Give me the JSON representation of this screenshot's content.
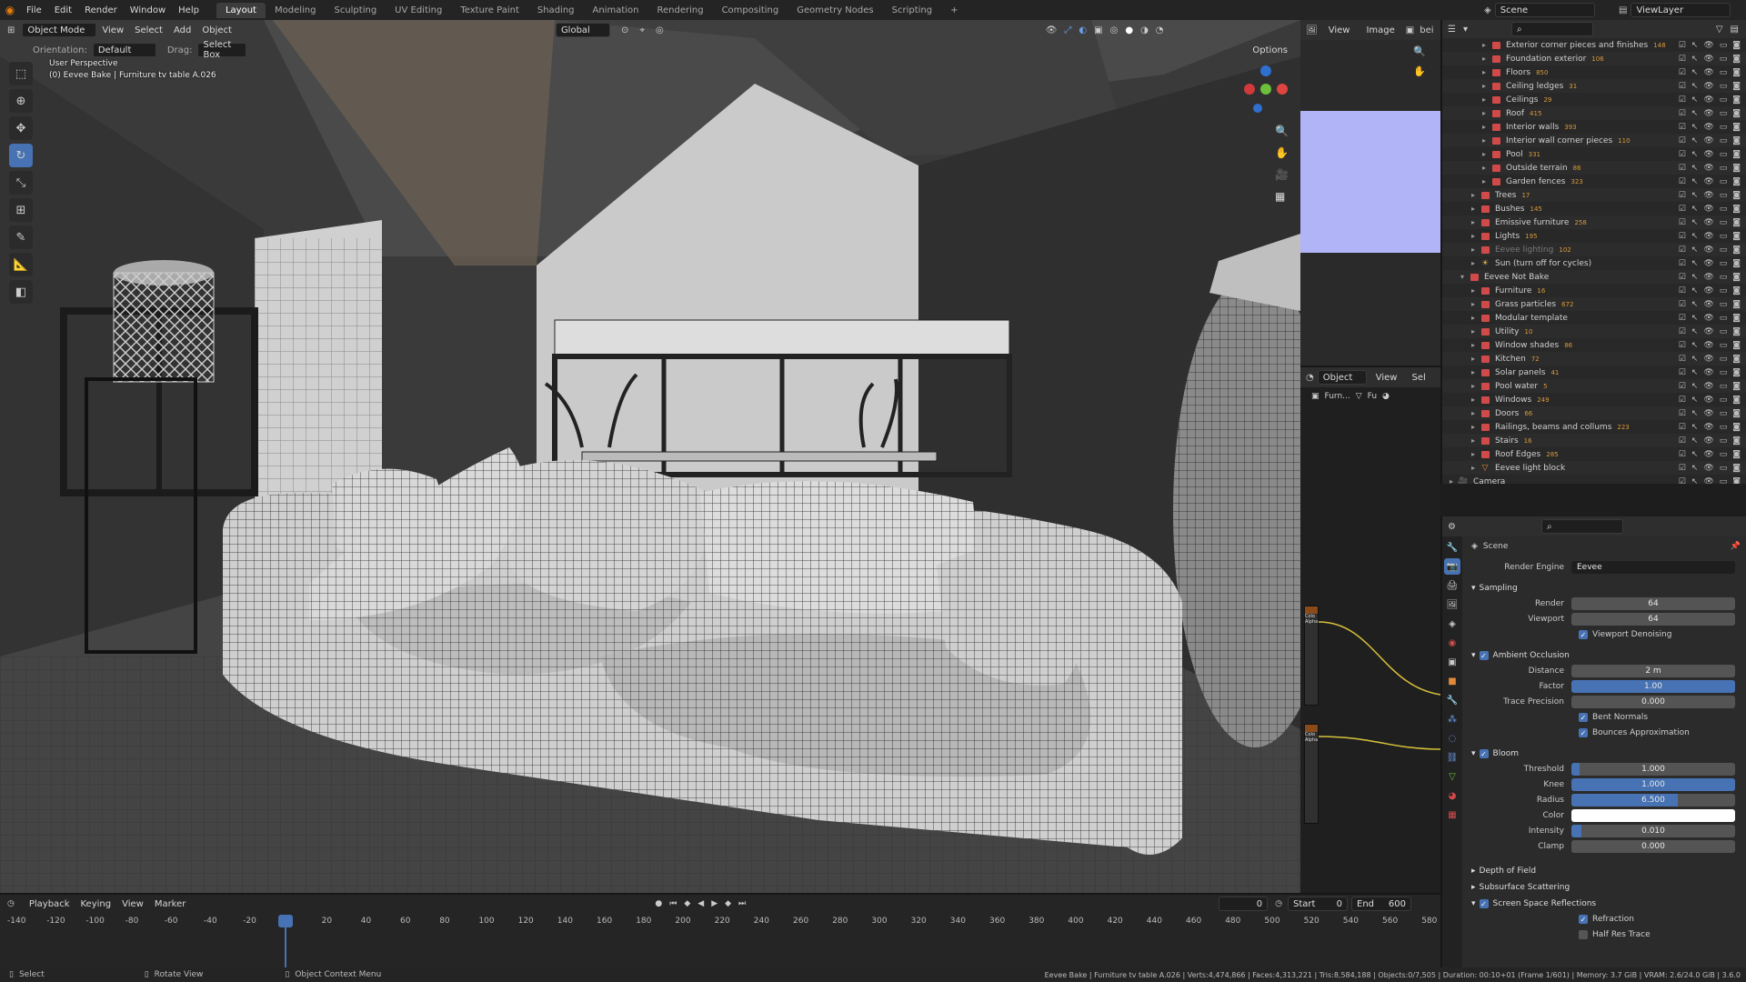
{
  "topbar": {
    "menus": [
      "File",
      "Edit",
      "Render",
      "Window",
      "Help"
    ],
    "workspaces": [
      "Layout",
      "Modeling",
      "Sculpting",
      "UV Editing",
      "Texture Paint",
      "Shading",
      "Animation",
      "Rendering",
      "Compositing",
      "Geometry Nodes",
      "Scripting"
    ],
    "active_workspace": "Layout",
    "add_workspace": "+",
    "scene_label": "Scene",
    "viewlayer_label": "ViewLayer"
  },
  "viewport": {
    "mode": "Object Mode",
    "menus": [
      "View",
      "Select",
      "Add",
      "Object"
    ],
    "orientation_label": "Orientation:",
    "orientation_value": "Default",
    "drag_label": "Drag:",
    "drag_value": "Select Box",
    "transform_orientation": "Global",
    "options_label": "Options",
    "overlay_title": "User Perspective",
    "overlay_subtitle": "(0) Eevee Bake | Furniture tv table A.026"
  },
  "image_editor": {
    "menus": [
      "View",
      "Image"
    ],
    "name_truncated": "bei"
  },
  "node_editor": {
    "mode": "Object",
    "menus": [
      "View",
      "Sel"
    ],
    "breadcrumb": [
      "Furn...",
      "Fu"
    ],
    "socket_labels": [
      "Colo",
      "Alpha",
      "Colo",
      "Alpha"
    ]
  },
  "outliner": {
    "rows": [
      {
        "name": "Exterior corner pieces and finishes",
        "count": "148",
        "indent": 3,
        "dim": false
      },
      {
        "name": "Foundation exterior",
        "count": "106",
        "indent": 3,
        "dim": false
      },
      {
        "name": "Floors",
        "count": "850",
        "indent": 3,
        "dim": false
      },
      {
        "name": "Ceiling ledges",
        "count": "31",
        "indent": 3,
        "dim": false
      },
      {
        "name": "Ceilings",
        "count": "29",
        "indent": 3,
        "dim": false
      },
      {
        "name": "Roof",
        "count": "415",
        "indent": 3,
        "dim": false
      },
      {
        "name": "Interior walls",
        "count": "393",
        "indent": 3,
        "dim": false
      },
      {
        "name": "Interior wall corner pieces",
        "count": "110",
        "indent": 3,
        "dim": false
      },
      {
        "name": "Pool",
        "count": "331",
        "indent": 3,
        "dim": false
      },
      {
        "name": "Outside terrain",
        "count": "86",
        "indent": 3,
        "dim": false
      },
      {
        "name": "Garden fences",
        "count": "323",
        "indent": 3,
        "dim": false
      },
      {
        "name": "Trees",
        "count": "17",
        "indent": 2,
        "dim": false
      },
      {
        "name": "Bushes",
        "count": "145",
        "indent": 2,
        "dim": false
      },
      {
        "name": "Emissive furniture",
        "count": "258",
        "indent": 2,
        "dim": false
      },
      {
        "name": "Lights",
        "count": "195",
        "indent": 2,
        "dim": false
      },
      {
        "name": "Eevee lighting",
        "count": "102",
        "indent": 2,
        "dim": true
      },
      {
        "name": "Sun (turn off for cycles)",
        "count": "",
        "indent": 2,
        "dim": false,
        "sun": true
      },
      {
        "name": "Eevee Not Bake",
        "count": "",
        "indent": 1,
        "dim": false
      },
      {
        "name": "Furniture",
        "count": "16",
        "indent": 2,
        "dim": false
      },
      {
        "name": "Grass particles",
        "count": "672",
        "indent": 2,
        "dim": false
      },
      {
        "name": "Modular template",
        "count": "",
        "indent": 2,
        "dim": false
      },
      {
        "name": "Utility",
        "count": "10",
        "indent": 2,
        "dim": false
      },
      {
        "name": "Window shades",
        "count": "86",
        "indent": 2,
        "dim": false
      },
      {
        "name": "Kitchen",
        "count": "72",
        "indent": 2,
        "dim": false
      },
      {
        "name": "Solar panels",
        "count": "41",
        "indent": 2,
        "dim": false
      },
      {
        "name": "Pool water",
        "count": "5",
        "indent": 2,
        "dim": false
      },
      {
        "name": "Windows",
        "count": "249",
        "indent": 2,
        "dim": false
      },
      {
        "name": "Doors",
        "count": "66",
        "indent": 2,
        "dim": false
      },
      {
        "name": "Railings, beams and collums",
        "count": "223",
        "indent": 2,
        "dim": false
      },
      {
        "name": "Stairs",
        "count": "16",
        "indent": 2,
        "dim": false
      },
      {
        "name": "Roof Edges",
        "count": "285",
        "indent": 2,
        "dim": false
      },
      {
        "name": "Eevee light block",
        "count": "",
        "indent": 2,
        "dim": false,
        "mesh": true
      },
      {
        "name": "Camera",
        "count": "",
        "indent": 0,
        "dim": false,
        "camera": true
      }
    ]
  },
  "properties": {
    "context": "Scene",
    "render_engine_label": "Render Engine",
    "render_engine_value": "Eevee",
    "sampling": {
      "title": "Sampling",
      "render_label": "Render",
      "render_value": "64",
      "viewport_label": "Viewport",
      "viewport_value": "64",
      "denoise_label": "Viewport Denoising"
    },
    "ao": {
      "title": "Ambient Occlusion",
      "distance_label": "Distance",
      "distance_value": "2 m",
      "factor_label": "Factor",
      "factor_value": "1.00",
      "trace_label": "Trace Precision",
      "trace_value": "0.000",
      "bent_label": "Bent Normals",
      "bounce_label": "Bounces Approximation"
    },
    "bloom": {
      "title": "Bloom",
      "threshold_label": "Threshold",
      "threshold_value": "1.000",
      "threshold_fill": 0.05,
      "knee_label": "Knee",
      "knee_value": "1.000",
      "knee_fill": 1.0,
      "radius_label": "Radius",
      "radius_value": "6.500",
      "radius_fill": 0.65,
      "color_label": "Color",
      "color_value": "#ffffff",
      "intensity_label": "Intensity",
      "intensity_value": "0.010",
      "intensity_fill": 0.06,
      "clamp_label": "Clamp",
      "clamp_value": "0.000"
    },
    "dof_title": "Depth of Field",
    "sss_title": "Subsurface Scattering",
    "ssr": {
      "title": "Screen Space Reflections",
      "refraction_label": "Refraction",
      "halfres_label": "Half Res Trace"
    }
  },
  "timeline": {
    "menus": [
      "Playback",
      "Keying",
      "View",
      "Marker"
    ],
    "current_frame": "0",
    "start_label": "Start",
    "start_value": "0",
    "end_label": "End",
    "end_value": "600",
    "ruler": [
      "-140",
      "-120",
      "-100",
      "-80",
      "-60",
      "-40",
      "-20",
      "0",
      "20",
      "40",
      "60",
      "80",
      "100",
      "120",
      "140",
      "160",
      "180",
      "200",
      "220",
      "240",
      "260",
      "280",
      "300",
      "320",
      "340",
      "360",
      "380",
      "400",
      "420",
      "440",
      "460",
      "480",
      "500",
      "520",
      "540",
      "560",
      "580"
    ]
  },
  "statusbar": {
    "select": "Select",
    "rotate": "Rotate View",
    "context": "Object Context Menu",
    "stats": "Eevee Bake | Furniture tv table A.026 | Verts:4,474,866 | Faces:4,313,221 | Tris:8,584,188 | Objects:0/7,505 | Duration: 00:10+01 (Frame 1/601) | Memory: 3.7 GiB | VRAM: 2.6/24.0 GiB | 3.6.0"
  },
  "colors": {
    "accent": "#4772b3",
    "collection": "#d14a4a",
    "image_preview": "#b2b4f8"
  }
}
